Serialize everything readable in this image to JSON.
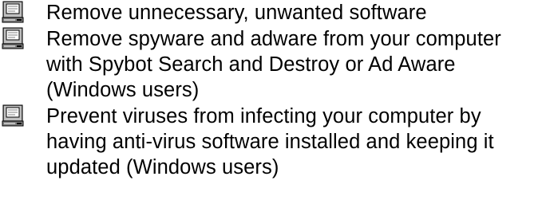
{
  "bullet_icon": "computer-monitor-icon",
  "items": [
    {
      "text": "Remove unnecessary, unwanted software"
    },
    {
      "text": "Remove spyware and adware from your computer with Spybot Search and Destroy or Ad Aware (Windows users)"
    },
    {
      "text": "Prevent viruses from infecting your computer by having anti-virus software installed and keeping it updated (Windows users)"
    }
  ]
}
